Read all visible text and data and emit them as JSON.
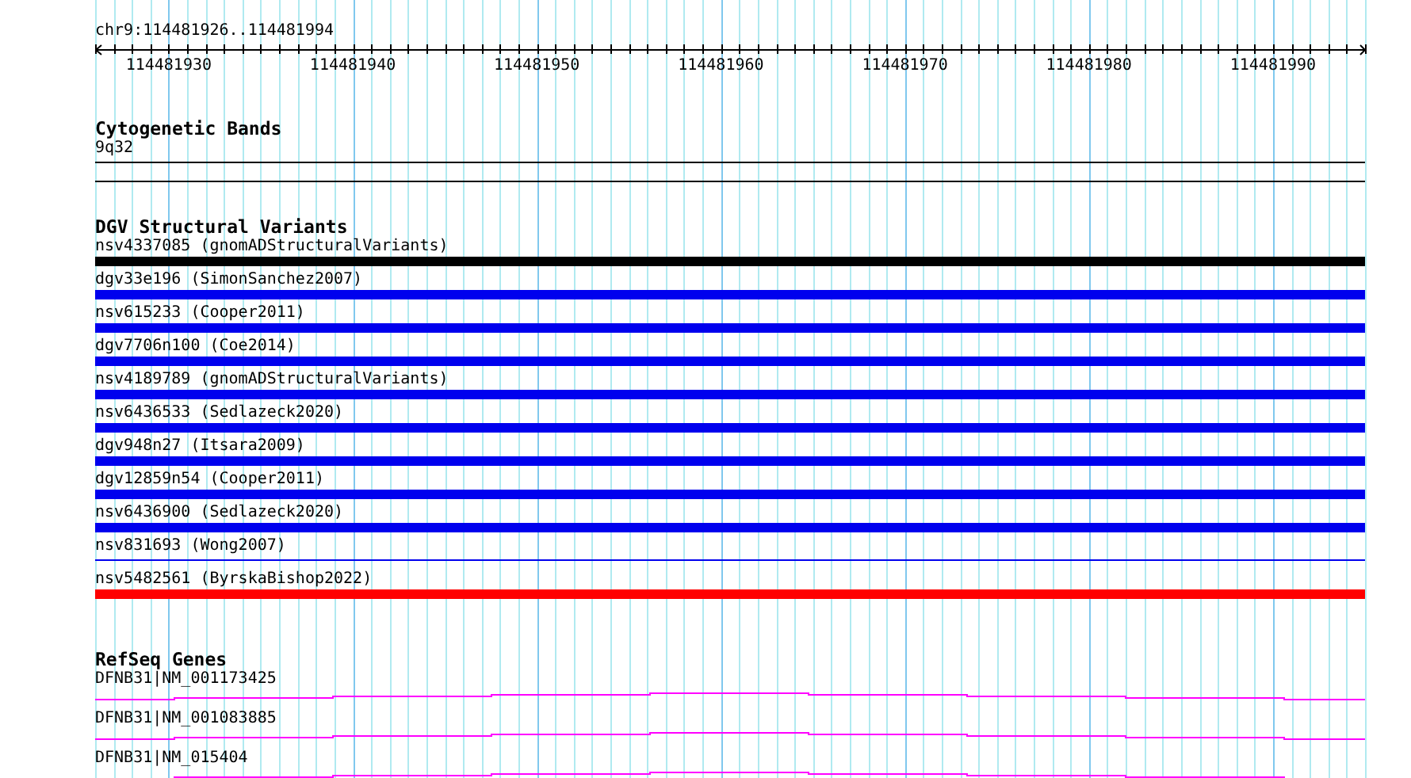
{
  "location": "chr9:114481926..114481994",
  "ruler": {
    "labels": [
      "114481930",
      "114481940",
      "114481950",
      "114481960",
      "114481970",
      "114481980",
      "114481990"
    ]
  },
  "tracks": [
    {
      "kind": "cytoband",
      "title": "Cytogenetic Bands",
      "items": [
        {
          "label": "9q32",
          "kind": "line",
          "color": "#000000"
        }
      ]
    },
    {
      "kind": "variants",
      "title": "DGV Structural Variants",
      "items": [
        {
          "label": "nsv4337085 (gnomADStructuralVariants)",
          "kind": "bar",
          "color": "#000000"
        },
        {
          "label": "dgv33e196 (SimonSanchez2007)",
          "kind": "bar",
          "color": "#0000ee"
        },
        {
          "label": "nsv615233 (Cooper2011)",
          "kind": "bar",
          "color": "#0000ee"
        },
        {
          "label": "dgv7706n100 (Coe2014)",
          "kind": "bar",
          "color": "#0000ee"
        },
        {
          "label": "nsv4189789 (gnomADStructuralVariants)",
          "kind": "bar",
          "color": "#0000ee"
        },
        {
          "label": "nsv6436533 (Sedlazeck2020)",
          "kind": "bar",
          "color": "#0000ee"
        },
        {
          "label": "dgv948n27 (Itsara2009)",
          "kind": "bar",
          "color": "#0000ee"
        },
        {
          "label": "dgv12859n54 (Cooper2011)",
          "kind": "bar",
          "color": "#0000ee"
        },
        {
          "label": "nsv6436900 (Sedlazeck2020)",
          "kind": "bar",
          "color": "#0000ee"
        },
        {
          "label": "nsv831693 (Wong2007)",
          "kind": "line",
          "color": "#0000ee"
        },
        {
          "label": "nsv5482561 (ByrskaBishop2022)",
          "kind": "bar",
          "color": "#ff0000"
        }
      ]
    },
    {
      "kind": "genes",
      "title": "RefSeq Genes",
      "items": [
        {
          "label": "DFNB31|NM_001173425",
          "kind": "gene",
          "color": "#ff00ff"
        },
        {
          "label": "DFNB31|NM_001083885",
          "kind": "gene",
          "color": "#ff00ff"
        },
        {
          "label": "DFNB31|NM_015404",
          "kind": "gene",
          "color": "#ff00ff"
        }
      ]
    }
  ]
}
